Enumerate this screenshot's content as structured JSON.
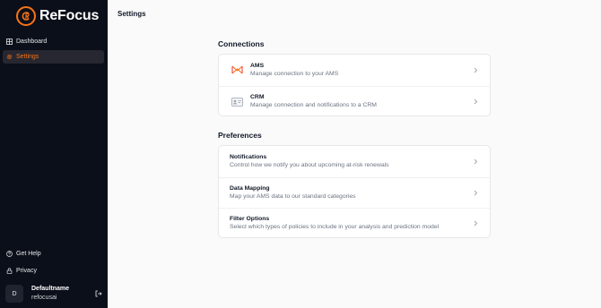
{
  "brand": {
    "name": "ReFocus",
    "accent": "#f97316"
  },
  "sidebar": {
    "items": [
      {
        "label": "Dashboard",
        "icon": "dashboard-icon",
        "active": false
      },
      {
        "label": "Settings",
        "icon": "gear-icon",
        "active": true
      }
    ],
    "bottom_items": [
      {
        "label": "Get Help",
        "icon": "help-circle-icon"
      },
      {
        "label": "Privacy",
        "icon": "lock-icon"
      }
    ],
    "user": {
      "initial": "D",
      "name": "Defaultname",
      "handle": "refocusai"
    }
  },
  "header": {
    "title": "Settings"
  },
  "connections": {
    "title": "Connections",
    "items": [
      {
        "title": "AMS",
        "description": "Manage connection to your AMS",
        "icon": "ams-logo-icon"
      },
      {
        "title": "CRM",
        "description": "Manage connection and notifications to a CRM",
        "icon": "id-card-icon"
      }
    ]
  },
  "preferences": {
    "title": "Preferences",
    "items": [
      {
        "title": "Notifications",
        "description": "Control how we notify you about upcoming at-risk renewals"
      },
      {
        "title": "Data Mapping",
        "description": "Map your AMS data to our standard categories"
      },
      {
        "title": "Filter Options",
        "description": "Select which types of policies to include in your analysis and prediction model"
      }
    ]
  }
}
